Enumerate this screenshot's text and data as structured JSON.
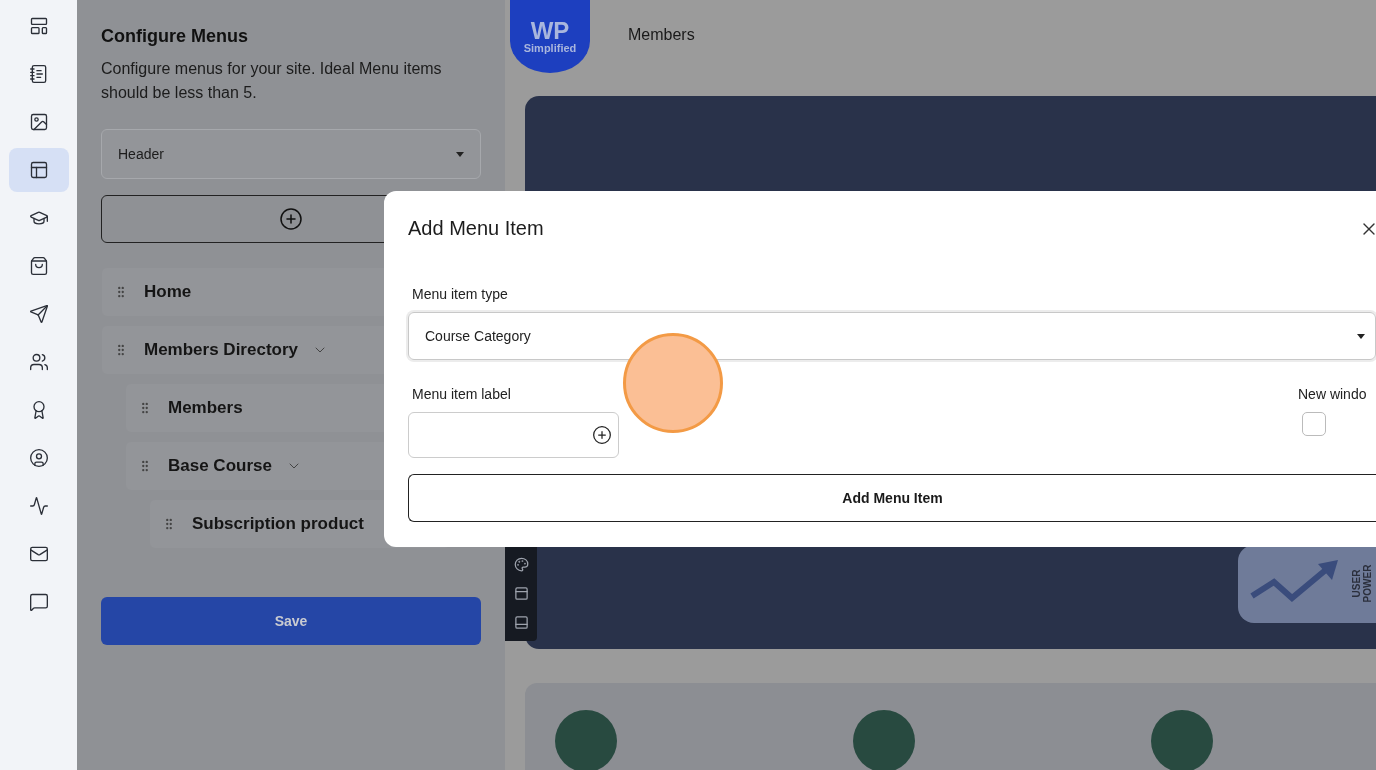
{
  "sidebar": {
    "items": [
      {
        "selected": false
      },
      {
        "selected": false
      },
      {
        "selected": false
      },
      {
        "selected": true
      },
      {
        "selected": false
      },
      {
        "selected": false
      },
      {
        "selected": false
      },
      {
        "selected": false
      },
      {
        "selected": false
      },
      {
        "selected": false
      },
      {
        "selected": false
      },
      {
        "selected": false
      },
      {
        "selected": false
      }
    ]
  },
  "menu_panel": {
    "title": "Configure Menus",
    "description": "Configure menus for your site. Ideal Menu items should be less than 5.",
    "menu_select": {
      "value": "Header"
    },
    "save_button": "Save",
    "items": [
      {
        "label": "Home"
      },
      {
        "label": "Members Directory",
        "expanded": true,
        "children": [
          {
            "label": "Members"
          },
          {
            "label": "Base Course",
            "expanded": true,
            "children": [
              {
                "label": "Subscription product"
              }
            ]
          }
        ]
      }
    ]
  },
  "site": {
    "logo": {
      "top": "WP",
      "bottom": "Simplified"
    },
    "nav": [
      "Members"
    ],
    "banner_badge": [
      "USER",
      "POWER"
    ]
  },
  "dialog": {
    "title": "Add Menu Item",
    "type_label": "Menu item type",
    "type_value": "Course Category",
    "label_label": "Menu item label",
    "new_window_label": "New windo",
    "new_window_checked": false,
    "submit": "Add Menu Item"
  }
}
